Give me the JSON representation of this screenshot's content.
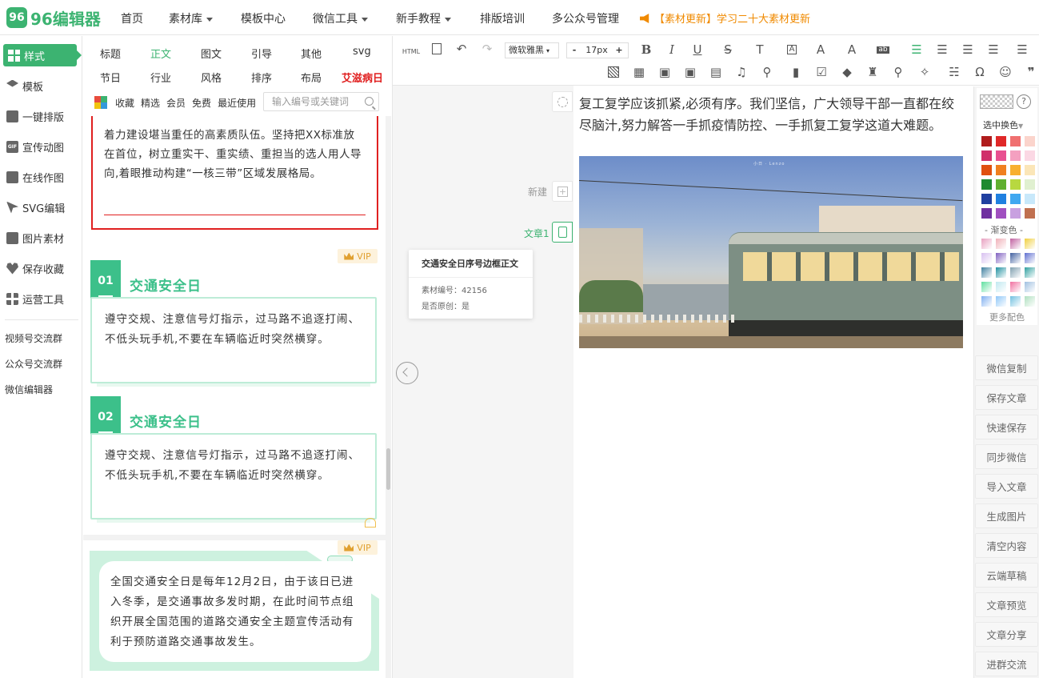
{
  "app": {
    "logo_badge": "96",
    "logo_text": "96编辑器"
  },
  "topnav": {
    "items": [
      {
        "label": "首页",
        "dropdown": false
      },
      {
        "label": "素材库",
        "dropdown": true
      },
      {
        "label": "模板中心",
        "dropdown": false
      },
      {
        "label": "微信工具",
        "dropdown": true
      },
      {
        "label": "新手教程",
        "dropdown": true
      },
      {
        "label": "排版培训",
        "dropdown": false
      },
      {
        "label": "多公众号管理",
        "dropdown": false
      }
    ],
    "news": "【素材更新】学习二十大素材更新"
  },
  "sidebar": {
    "items": [
      {
        "label": "样式",
        "icon": "grid-icon",
        "active": true
      },
      {
        "label": "模板",
        "icon": "layers-icon"
      },
      {
        "label": "一键排版",
        "icon": "copy-icon"
      },
      {
        "label": "宣传动图",
        "icon": "gif-icon"
      },
      {
        "label": "在线作图",
        "icon": "edit-icon"
      },
      {
        "label": "SVG编辑",
        "icon": "cursor-icon"
      },
      {
        "label": "图片素材",
        "icon": "image-icon"
      },
      {
        "label": "保存收藏",
        "icon": "heart-icon"
      },
      {
        "label": "运营工具",
        "icon": "apps-icon"
      }
    ],
    "groups": [
      "视频号交流群",
      "公众号交流群",
      "微信编辑器"
    ]
  },
  "categories": {
    "row1": [
      "标题",
      "正文",
      "图文",
      "引导",
      "其他",
      "svg"
    ],
    "row2": [
      "节日",
      "行业",
      "风格",
      "排序",
      "布局",
      "艾滋病日"
    ],
    "active": "正文",
    "highlight": "艾滋病日"
  },
  "filters": {
    "items": [
      "收藏",
      "精选",
      "会员",
      "免费",
      "最近使用"
    ],
    "search_placeholder": "输入编号或关键词"
  },
  "materials": {
    "card1_text": "着力建设堪当重任的高素质队伍。坚持把XX标准放在首位，树立重实干、重实绩、重担当的选人用人导向,着眼推动构建“一核三带”区域发展格局。",
    "vip_label": "VIP",
    "card2": {
      "items": [
        {
          "num": "01",
          "title": "交通安全日",
          "body": "遵守交规、注意信号灯指示，过马路不追逐打闹、不低头玩手机,不要在车辆临近时突然横穿。"
        },
        {
          "num": "02",
          "title": "交通安全日",
          "body": "遵守交规、注意信号灯指示，过马路不追逐打闹、不低头玩手机,不要在车辆临近时突然横穿。"
        }
      ]
    },
    "card3_text": "全国交通安全日是每年12月2日，由于该日已进入冬季，是交通事故多发时期，在此时间节点组织开展全国范围的道路交通安全主题宣传活动有利于预防道路交通事故发生。"
  },
  "middle": {
    "new_label": "新建",
    "article_label": "文章1",
    "tooltip": {
      "title": "交通安全日序号边框正文",
      "id_line": "素材编号：42156",
      "orig_line": "是否原创：是"
    }
  },
  "toolbar": {
    "font_family": "微软雅黑",
    "font_size": "17px",
    "minus": "-",
    "plus": "+",
    "html_label": "HTML"
  },
  "editor": {
    "text": "复工复学应该抓紧,必须有序。我们坚信，广大领导干部一直都在绞尽脑汁,努力解答一手抓疫情防控、一手抓复工复学这道大难题。",
    "image_caption": "小日 · Lenzo"
  },
  "palette": {
    "select_label": "选中换色",
    "gradient_label": "- 渐变色 -",
    "more_label": "更多配色",
    "solid": [
      [
        "#b01c1c",
        "#e02828",
        "#f07070",
        "#fbd4cc"
      ],
      [
        "#d0306a",
        "#e85090",
        "#f4a0c0",
        "#fbd8e4"
      ],
      [
        "#e05010",
        "#f08020",
        "#f8b030",
        "#fbe6b8"
      ],
      [
        "#1e8a30",
        "#60b030",
        "#b8d840",
        "#e0f0d0"
      ],
      [
        "#2040a0",
        "#2080e0",
        "#40a8f0",
        "#c8e8fa"
      ],
      [
        "#7030a0",
        "#a050c0",
        "#c8a0e0",
        "#c07050"
      ]
    ],
    "gradients": [
      [
        "#e8a0c0",
        "#f0b0b8",
        "#c060a0",
        "#f0d040"
      ],
      [
        "#d8c0f0",
        "#8060c0",
        "#4060a0",
        "#6070d0"
      ],
      [
        "#4080a0",
        "#2090a0",
        "#80a0b0",
        "#30a0a0"
      ],
      [
        "#60e0a0",
        "#c0e8f0",
        "#f070a0",
        "#a0c0e0"
      ],
      [
        "#80b0f0",
        "#90c8f8",
        "#70c0e0",
        "#b0e0c0"
      ]
    ]
  },
  "actions": [
    "微信复制",
    "保存文章",
    "快速保存",
    "同步微信",
    "导入文章",
    "生成图片",
    "清空内容",
    "云端草稿",
    "文章预览",
    "文章分享",
    "进群交流"
  ]
}
